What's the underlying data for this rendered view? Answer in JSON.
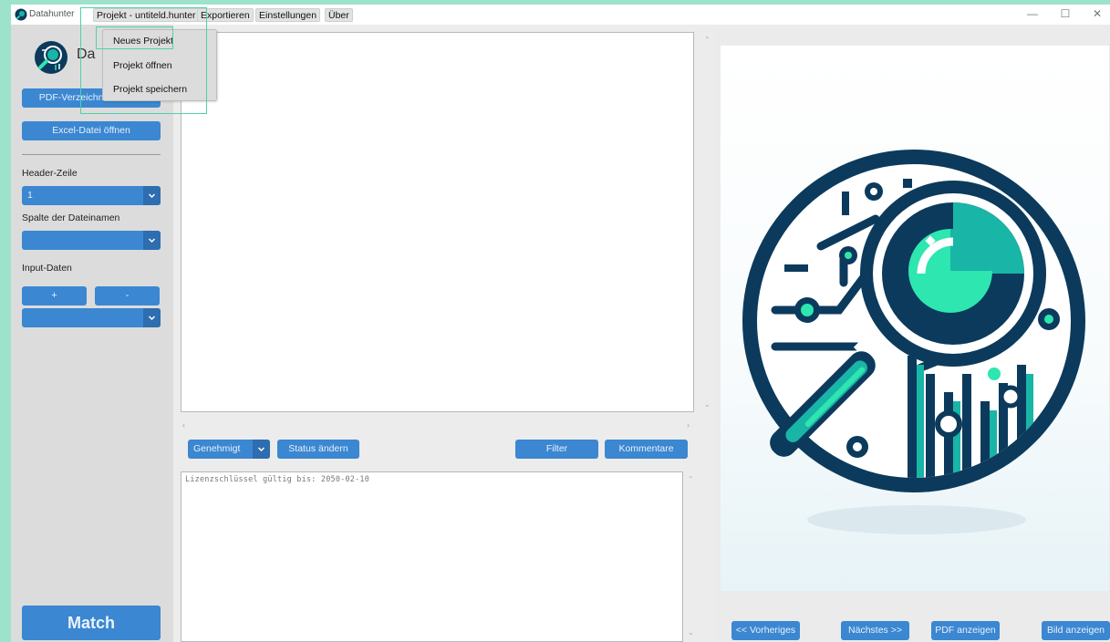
{
  "window": {
    "title": "Datahunter",
    "controls": {
      "minimize": "—",
      "maximize": "☐",
      "close": "✕"
    }
  },
  "menubar": {
    "items": [
      {
        "label": "Projekt - untiteld.hunter"
      },
      {
        "label": "Exportieren"
      },
      {
        "label": "Einstellungen"
      },
      {
        "label": "Über"
      }
    ]
  },
  "project_menu": {
    "items": [
      {
        "label": "Neues Projekt"
      },
      {
        "label": "Projekt öffnen"
      },
      {
        "label": "Projekt speichern"
      }
    ]
  },
  "sidebar": {
    "logo_text": "Da",
    "pdf_dir_button": "PDF-Verzeichnis wählen",
    "excel_button": "Excel-Datei öffnen",
    "header_row_label": "Header-Zeile",
    "header_row_value": "1",
    "filename_column_label": "Spalte der Dateinamen",
    "filename_column_value": "",
    "input_data_label": "Input-Daten",
    "add_button": "+",
    "remove_button": "-",
    "input_data_value": "",
    "match_button": "Match"
  },
  "center": {
    "status_value": "Genehmigt",
    "status_change_button": "Status ändern",
    "filter_button": "Filter",
    "comments_button": "Kommentare",
    "log_text": "Lizenzschlüssel gültig bis: 2050-02-10"
  },
  "right": {
    "prev_button": "<< Vorheriges",
    "next_button": "Nächstes >>",
    "pdf_button": "PDF anzeigen",
    "image_button": "Bild anzeigen"
  },
  "colors": {
    "accent": "#3b87d1",
    "accent_dark": "#2d6db0",
    "highlight": "#4fd1ad",
    "logo_navy": "#0b3a5c",
    "logo_teal": "#19b5a7",
    "logo_green": "#2ee6b0"
  },
  "icons": {
    "app": "datahunter-logo-icon",
    "dropdown": "chevron-down-icon"
  }
}
